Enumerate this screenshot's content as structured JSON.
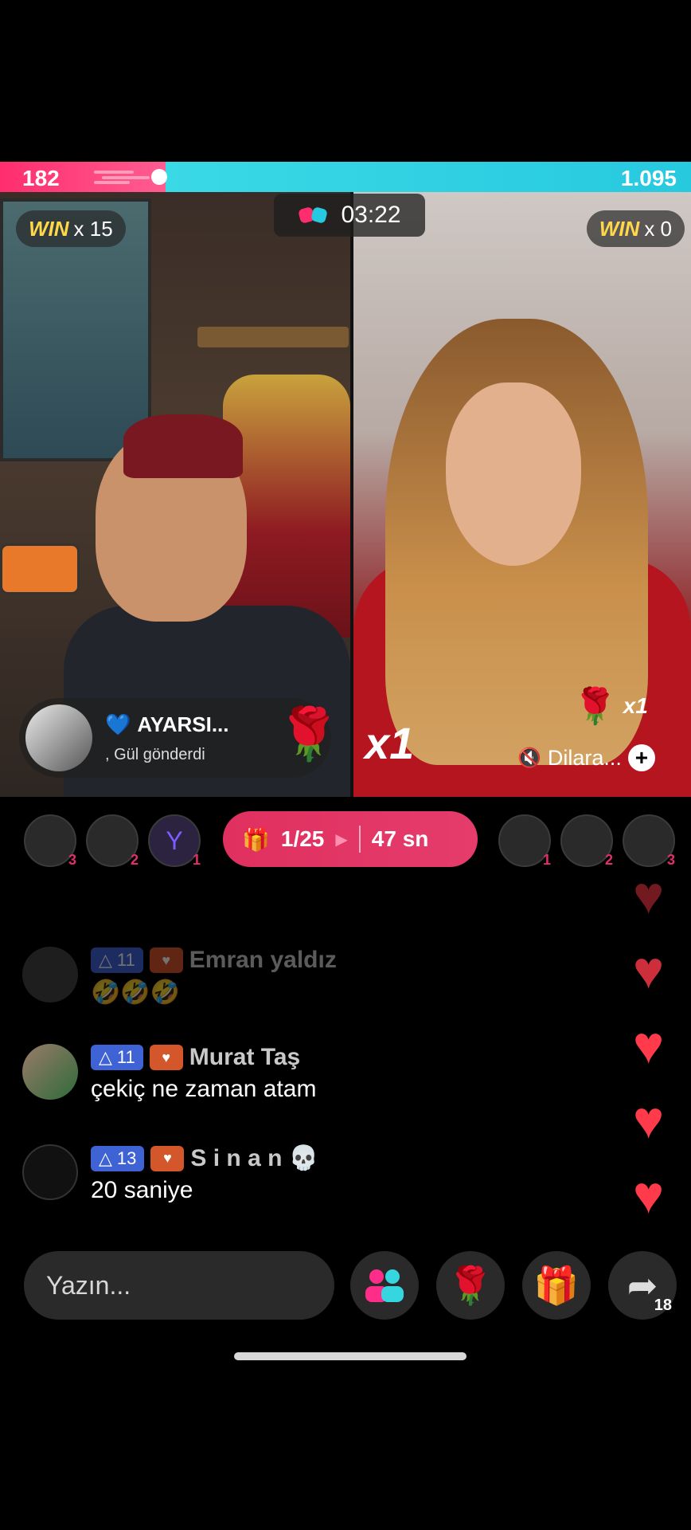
{
  "battle": {
    "left_score": "182",
    "right_score": "1.095",
    "timer": "03:22",
    "left_win_label": "WIN",
    "left_win_count": "x 15",
    "right_win_label": "WIN",
    "right_win_count": "x 0",
    "left_score_share": 0.14
  },
  "gift_notice": {
    "user": "AYARSI...",
    "text": ", Gül  gönderdi",
    "gift_icon": "rose-icon"
  },
  "opponent": {
    "rose_multiplier": "x1",
    "big_multiplier": "x1",
    "name": "Dilara...",
    "plus": "+"
  },
  "round": {
    "gift_progress": "1/25",
    "time_left": "47 sn"
  },
  "left_gifters": [
    {
      "rank": "3"
    },
    {
      "rank": "2"
    },
    {
      "rank": "1",
      "letter": "Y"
    }
  ],
  "right_gifters": [
    {
      "rank": "1"
    },
    {
      "rank": "2"
    },
    {
      "rank": "3"
    }
  ],
  "comments": [
    {
      "level": "11",
      "name": "Emran yaldız",
      "text": "🤣🤣🤣"
    },
    {
      "level": "11",
      "name": "Murat Taş",
      "text": "çekiç ne zaman atam"
    },
    {
      "level": "13",
      "name": "S i n a n 💀",
      "text": "20 saniye"
    }
  ],
  "composer": {
    "placeholder": "Yazın...",
    "share_count": "18"
  },
  "colors": {
    "left_team": "#ff2d6e",
    "right_team": "#27c9df",
    "round_pill": "#e0305f",
    "win_gold": "#ffd84a"
  }
}
